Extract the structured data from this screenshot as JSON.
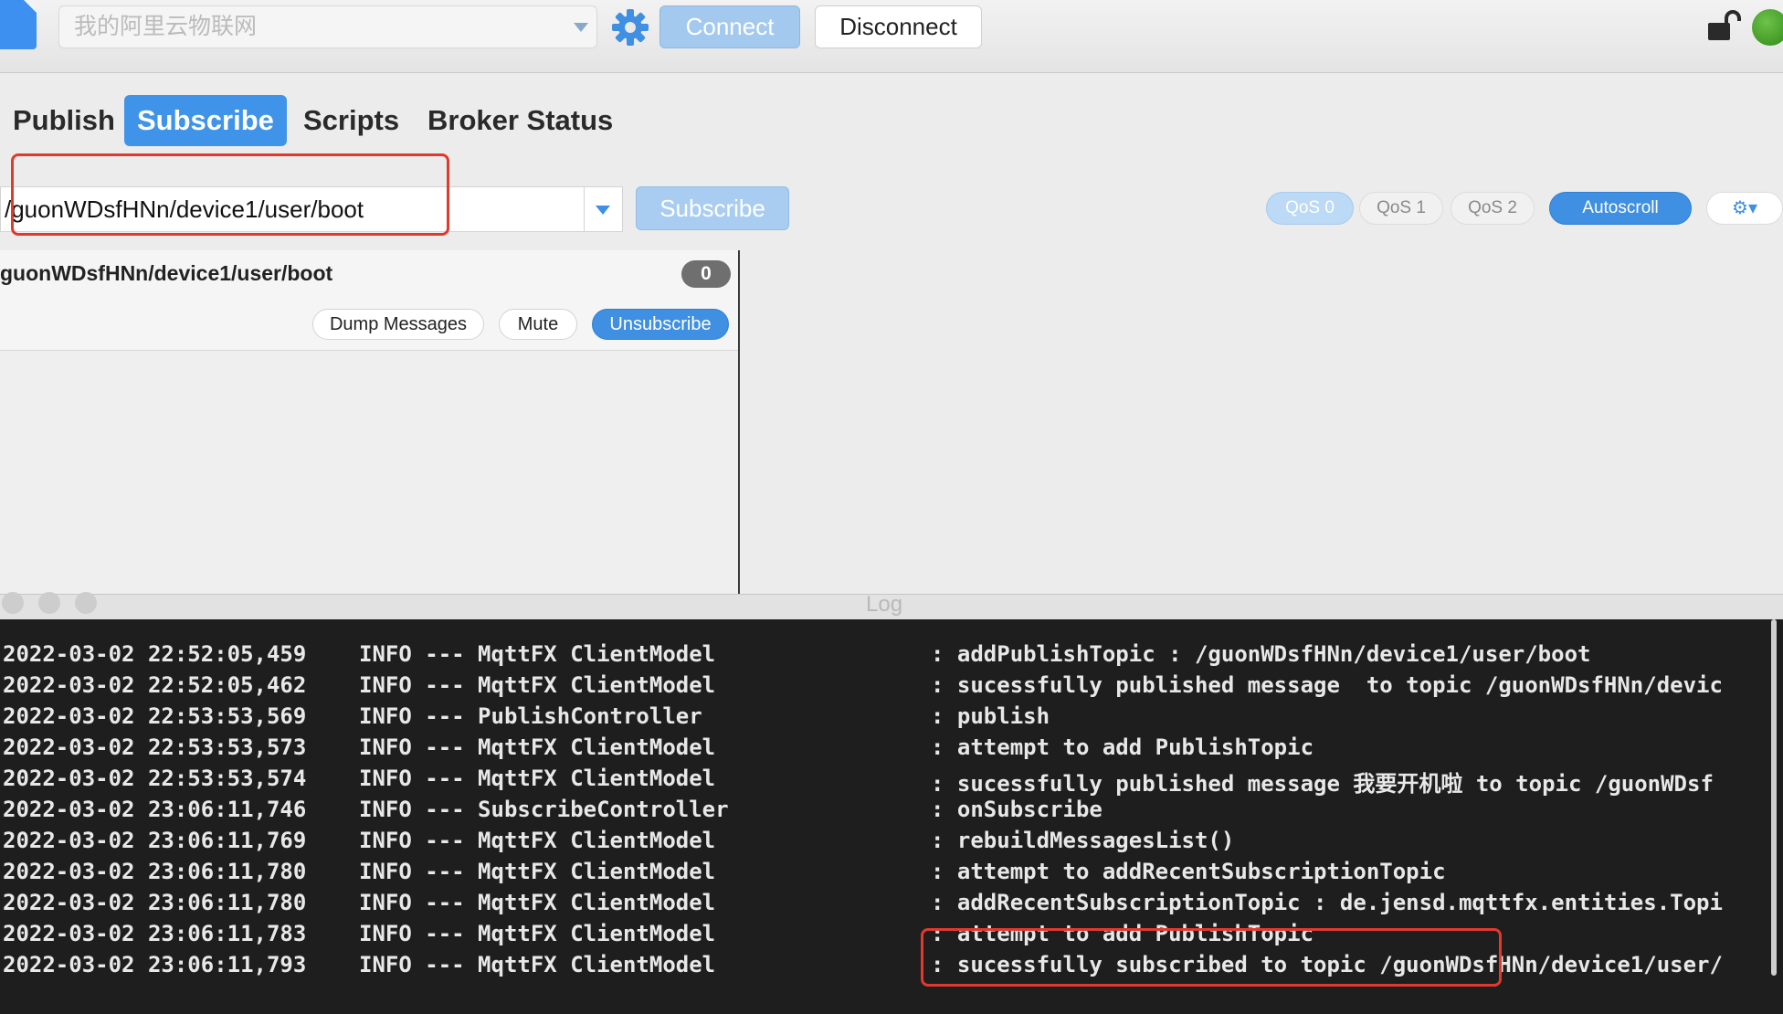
{
  "toolbar": {
    "profile_name": "我的阿里云物联网",
    "connect_label": "Connect",
    "disconnect_label": "Disconnect"
  },
  "tabs": [
    {
      "label": "Publish"
    },
    {
      "label": "Subscribe"
    },
    {
      "label": "Scripts"
    },
    {
      "label": "Broker Status"
    }
  ],
  "subscribe": {
    "topic_value": "/guonWDsfHNn/device1/user/boot",
    "subscribe_label": "Subscribe",
    "qos": [
      "QoS 0",
      "QoS 1",
      "QoS 2"
    ],
    "autoscroll_label": "Autoscroll"
  },
  "subscription": {
    "topic": "guonWDsfHNn/device1/user/boot",
    "count": "0",
    "dump_label": "Dump Messages",
    "mute_label": "Mute",
    "unsubscribe_label": "Unsubscribe"
  },
  "log": {
    "title": "Log",
    "lines": [
      {
        "time": "2022-03-02 22:52:05,459",
        "level": "INFO --- MqttFX ClientModel",
        "msg": ": addPublishTopic : /guonWDsfHNn/device1/user/boot"
      },
      {
        "time": "2022-03-02 22:52:05,462",
        "level": "INFO --- MqttFX ClientModel",
        "msg": ": sucessfully published message  to topic /guonWDsfHNn/devic"
      },
      {
        "time": "2022-03-02 22:53:53,569",
        "level": "INFO --- PublishController",
        "msg": ": publish"
      },
      {
        "time": "2022-03-02 22:53:53,573",
        "level": "INFO --- MqttFX ClientModel",
        "msg": ": attempt to add PublishTopic"
      },
      {
        "time": "2022-03-02 22:53:53,574",
        "level": "INFO --- MqttFX ClientModel",
        "msg": ": sucessfully published message 我要开机啦 to topic /guonWDsf"
      },
      {
        "time": "2022-03-02 23:06:11,746",
        "level": "INFO --- SubscribeController",
        "msg": ": onSubscribe"
      },
      {
        "time": "2022-03-02 23:06:11,769",
        "level": "INFO --- MqttFX ClientModel",
        "msg": ": rebuildMessagesList()"
      },
      {
        "time": "2022-03-02 23:06:11,780",
        "level": "INFO --- MqttFX ClientModel",
        "msg": ": attempt to addRecentSubscriptionTopic"
      },
      {
        "time": "2022-03-02 23:06:11,780",
        "level": "INFO --- MqttFX ClientModel",
        "msg": ": addRecentSubscriptionTopic : de.jensd.mqttfx.entities.Topi"
      },
      {
        "time": "2022-03-02 23:06:11,783",
        "level": "INFO --- MqttFX ClientModel",
        "msg": ": attempt to add PublishTopic"
      },
      {
        "time": "2022-03-02 23:06:11,793",
        "level": "INFO --- MqttFX ClientModel",
        "msg": ": sucessfully subscribed to topic /guonWDsfHNn/device1/user/"
      }
    ]
  },
  "colors": {
    "accent": "#3f94ea",
    "highlight": "#e2392e",
    "status_connected": "#3fa020",
    "log_background": "#1e1e1e"
  },
  "icons": {
    "file": "file-icon",
    "settings": "gear-icon",
    "lock": "unlocked-icon",
    "status": "status-dot"
  }
}
